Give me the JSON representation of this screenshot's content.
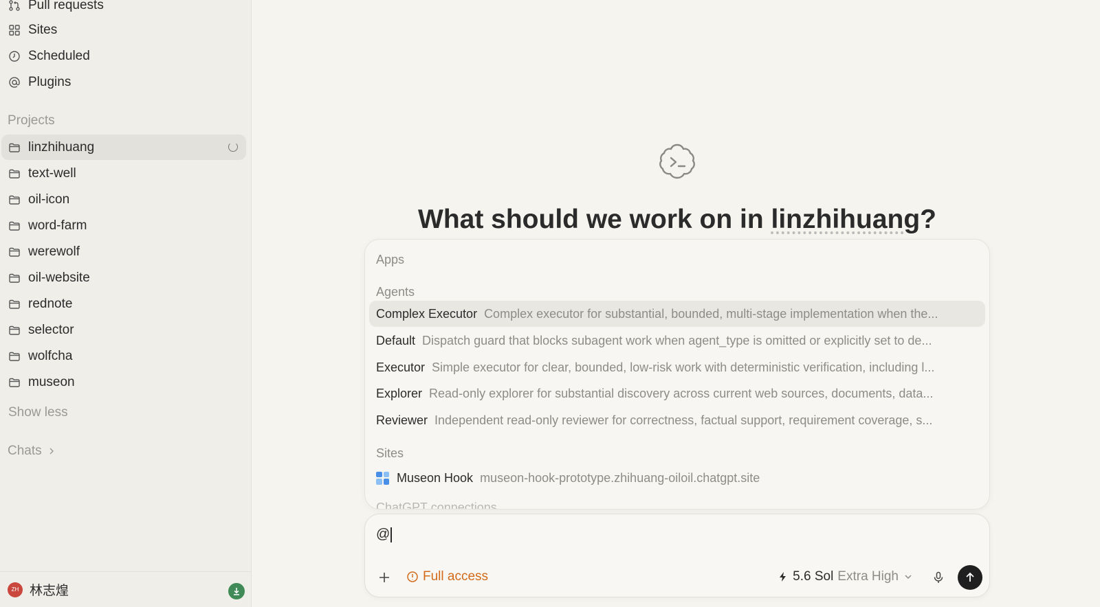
{
  "sidebar": {
    "nav": [
      {
        "label": "Pull requests",
        "icon": "pull-request-icon"
      },
      {
        "label": "Sites",
        "icon": "grid-icon"
      },
      {
        "label": "Scheduled",
        "icon": "clock-icon"
      },
      {
        "label": "Plugins",
        "icon": "at-sign-icon"
      }
    ],
    "projects_label": "Projects",
    "projects": [
      "linzhihuang",
      "text-well",
      "oil-icon",
      "word-farm",
      "werewolf",
      "oil-website",
      "rednote",
      "selector",
      "wolfcha",
      "museon"
    ],
    "show_less": "Show less",
    "chats_label": "Chats",
    "user": {
      "initials": "ZH",
      "name": "林志煌"
    }
  },
  "main": {
    "headline_prefix": "What should we work on in ",
    "headline_project": "linzhihuang",
    "headline_suffix": "?"
  },
  "dropdown": {
    "apps_label": "Apps",
    "agents_label": "Agents",
    "agents": [
      {
        "name": "Complex Executor",
        "desc": "Complex executor for substantial, bounded, multi-stage implementation when the..."
      },
      {
        "name": "Default",
        "desc": "Dispatch guard that blocks subagent work when agent_type is omitted or explicitly set to de..."
      },
      {
        "name": "Executor",
        "desc": "Simple executor for clear, bounded, low-risk work with deterministic verification, including l..."
      },
      {
        "name": "Explorer",
        "desc": "Read-only explorer for substantial discovery across current web sources, documents, data..."
      },
      {
        "name": "Reviewer",
        "desc": "Independent read-only reviewer for correctness, factual support, requirement coverage, s..."
      }
    ],
    "sites_label": "Sites",
    "sites": [
      {
        "name": "Museon Hook",
        "url": "museon-hook-prototype.zhihuang-oiloil.chatgpt.site"
      }
    ],
    "cut_label": "ChatGPT connections"
  },
  "composer": {
    "value": "@",
    "access_label": "Full access",
    "model_name": "5.6 Sol",
    "model_level": "Extra High"
  },
  "colors": {
    "sidebar_bg": "#efeee9",
    "main_bg": "#f5f4ef",
    "access_orange": "#d26a1a",
    "send_bg": "#1f1f1f",
    "download_green": "#3f8a56",
    "avatar_red": "#c9473d"
  }
}
